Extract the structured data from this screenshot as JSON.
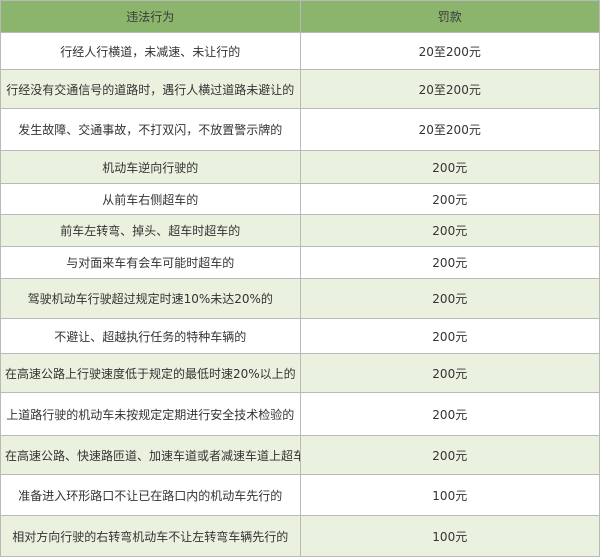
{
  "table": {
    "headers": [
      "违法行为",
      "罚款"
    ],
    "rows": [
      {
        "violation": "行经人行横道，未减速、未让行的",
        "fine": "20至200元"
      },
      {
        "violation": "行经没有交通信号的道路时，遇行人横过道路未避让的",
        "fine": "20至200元"
      },
      {
        "violation": "发生故障、交通事故，不打双闪，不放置警示牌的",
        "fine": "20至200元"
      },
      {
        "violation": "机动车逆向行驶的",
        "fine": "200元"
      },
      {
        "violation": "从前车右侧超车的",
        "fine": "200元"
      },
      {
        "violation": "前车左转弯、掉头、超车时超车的",
        "fine": "200元"
      },
      {
        "violation": "与对面来车有会车可能时超车的",
        "fine": "200元"
      },
      {
        "violation": "驾驶机动车行驶超过规定时速10%未达20%的",
        "fine": "200元"
      },
      {
        "violation": "不避让、超越执行任务的特种车辆的",
        "fine": "200元"
      },
      {
        "violation": "在高速公路上行驶速度低于规定的最低时速20%以上的",
        "fine": "200元"
      },
      {
        "violation": "上道路行驶的机动车未按规定定期进行安全技术检验的",
        "fine": "200元"
      },
      {
        "violation": "在高速公路、快速路匝道、加速车道或者减速车道上超车的",
        "fine": "200元"
      },
      {
        "violation": "准备进入环形路口不让已在路口内的机动车先行的",
        "fine": "100元"
      },
      {
        "violation": "相对方向行驶的右转弯机动车不让左转弯车辆先行的",
        "fine": "100元"
      }
    ]
  }
}
